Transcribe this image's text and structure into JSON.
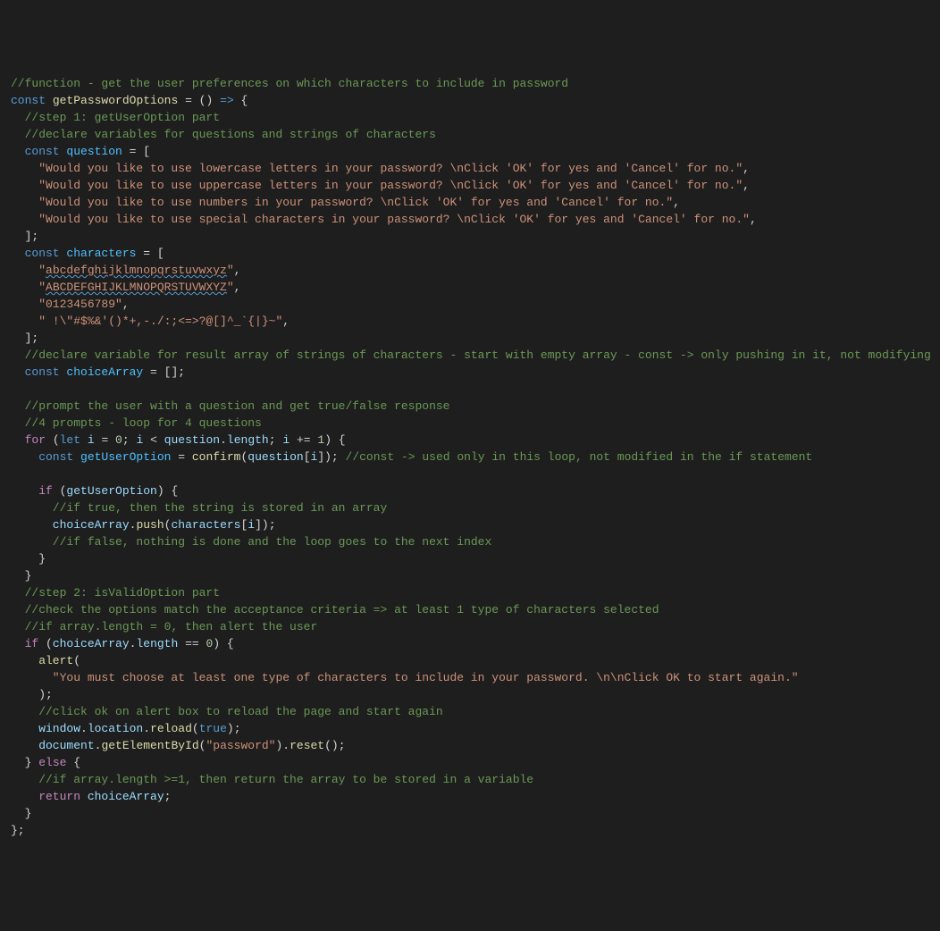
{
  "code": {
    "l1": "//function - get the user preferences on which characters to include in password",
    "l2a": "const",
    "l2b": "getPasswordOptions",
    "l2c": " = () ",
    "l2d": "=>",
    "l2e": " {",
    "l3": "  //step 1: getUserOption part",
    "l4": "  //declare variables for questions and strings of characters",
    "l5a": "  const",
    "l5b": " question",
    "l5c": " = [",
    "l6": "    \"Would you like to use lowercase letters in your password? \\nClick 'OK' for yes and 'Cancel' for no.\"",
    "l6p": ",",
    "l7": "    \"Would you like to use uppercase letters in your password? \\nClick 'OK' for yes and 'Cancel' for no.\"",
    "l7p": ",",
    "l8": "    \"Would you like to use numbers in your password? \\nClick 'OK' for yes and 'Cancel' for no.\"",
    "l8p": ",",
    "l9": "    \"Would you like to use special characters in your password? \\nClick 'OK' for yes and 'Cancel' for no.\"",
    "l9p": ",",
    "l10": "  ];",
    "l11a": "  const",
    "l11b": " characters",
    "l11c": " = [",
    "l12a": "    \"",
    "l12b": "abcdefghijklmnopqrstuvwxyz",
    "l12c": "\"",
    "l12p": ",",
    "l13a": "    \"",
    "l13b": "ABCDEFGHIJKLMNOPQRSTUVWXYZ",
    "l13c": "\"",
    "l13p": ",",
    "l14": "    \"0123456789\"",
    "l14p": ",",
    "l15": "    \" !\\\"#$%&'()*+,-./:;<=>?@[]^_`{|}~\"",
    "l15p": ",",
    "l16": "  ];",
    "l17": "  //declare variable for result array of strings of characters - start with empty array - const -> only pushing in it, not modifying",
    "l18a": "  const",
    "l18b": " choiceArray",
    "l18c": " = [];",
    "l20": "  //prompt the user with a question and get true/false response",
    "l21": "  //4 prompts - loop for 4 questions",
    "l22a": "  for",
    "l22b": " (",
    "l22c": "let",
    "l22d": " i",
    "l22e": " = ",
    "l22f": "0",
    "l22g": "; ",
    "l22h": "i",
    "l22i": " < ",
    "l22j": "question",
    "l22k": ".",
    "l22l": "length",
    "l22m": "; ",
    "l22n": "i",
    "l22o": " += ",
    "l22p": "1",
    "l22q": ") {",
    "l23a": "    const",
    "l23b": " getUserOption",
    "l23c": " = ",
    "l23d": "confirm",
    "l23e": "(",
    "l23f": "question",
    "l23g": "[",
    "l23h": "i",
    "l23i": "]); ",
    "l23j": "//const -> used only in this loop, not modified in the if statement",
    "l25a": "    if",
    "l25b": " (",
    "l25c": "getUserOption",
    "l25d": ") {",
    "l26": "      //if true, then the string is stored in an array",
    "l27a": "      choiceArray",
    "l27b": ".",
    "l27c": "push",
    "l27d": "(",
    "l27e": "characters",
    "l27f": "[",
    "l27g": "i",
    "l27h": "]);",
    "l28": "      //if false, nothing is done and the loop goes to the next index",
    "l29": "    }",
    "l30": "  }",
    "l31": "  //step 2: isValidOption part",
    "l32": "  //check the options match the acceptance criteria => at least 1 type of characters selected",
    "l33": "  //if array.length = 0, then alert the user",
    "l34a": "  if",
    "l34b": " (",
    "l34c": "choiceArray",
    "l34d": ".",
    "l34e": "length",
    "l34f": " == ",
    "l34g": "0",
    "l34h": ") {",
    "l35a": "    alert",
    "l35b": "(",
    "l36": "      \"You must choose at least one type of characters to include in your password. \\n\\nClick OK to start again.\"",
    "l37": "    );",
    "l38": "    //click ok on alert box to reload the page and start again",
    "l39a": "    window",
    "l39b": ".",
    "l39c": "location",
    "l39d": ".",
    "l39e": "reload",
    "l39f": "(",
    "l39g": "true",
    "l39h": ");",
    "l40a": "    document",
    "l40b": ".",
    "l40c": "getElementById",
    "l40d": "(",
    "l40e": "\"password\"",
    "l40f": ").",
    "l40g": "reset",
    "l40h": "();",
    "l41a": "  } ",
    "l41b": "else",
    "l41c": " {",
    "l42": "    //if array.length >=1, then return the array to be stored in a variable",
    "l43a": "    return",
    "l43b": " choiceArray",
    "l43c": ";",
    "l44": "  }",
    "l45": "};"
  }
}
